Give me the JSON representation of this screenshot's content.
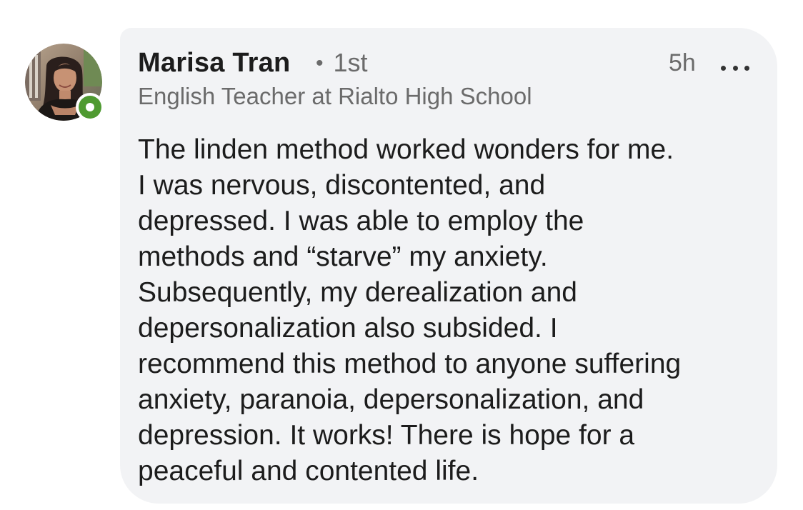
{
  "comment": {
    "author": {
      "name": "Marisa Tran",
      "connection_separator": "•",
      "connection_degree": "1st",
      "headline": "English Teacher at Rialto High School",
      "presence_status": "online",
      "presence_color": "#4f9a31",
      "avatar_icon": "profile-photo"
    },
    "time": "5h",
    "menu_icon": "more-horizontal-icon",
    "text_lines": [
      "The linden method worked wonders for me.",
      "I was nervous, discontented, and",
      "depressed. I was able to employ the",
      "methods and “starve” my anxiety.",
      "Subsequently, my derealization and",
      "depersonalization also subsided. I",
      "recommend this method to anyone suffering",
      "anxiety, paranoia, depersonalization, and",
      "depression. It works! There is hope for a",
      "peaceful and contented life."
    ]
  },
  "colors": {
    "bubble_background": "#f2f3f5",
    "secondary_text": "#6b6b6b",
    "primary_text": "#1c1c1c"
  }
}
